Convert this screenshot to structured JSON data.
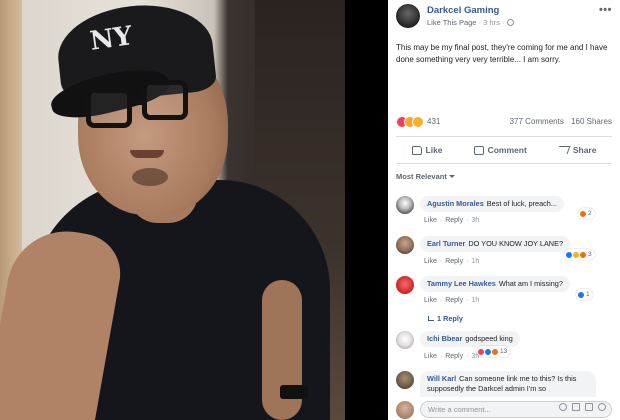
{
  "post": {
    "page_name": "Darkcel Gaming",
    "like_page": "Like This Page",
    "time": "3 hrs",
    "text": "This may be my final post, they're coming for me and I have done something very very terrible... I am sorry.",
    "reaction_count": "431",
    "comments_count": "377 Comments",
    "shares_count": "160 Shares",
    "actions": {
      "like": "Like",
      "comment": "Comment",
      "share": "Share"
    },
    "sort_label": "Most Relevant"
  },
  "comments": [
    {
      "name": "Agustin Morales",
      "text": "Best of luck, preach...",
      "like": "Like",
      "reply": "Reply",
      "time": "3h",
      "reaction_count": "2",
      "avatar_color": "#c8c8c8"
    },
    {
      "name": "Earl Turner",
      "text": "DO YOU KNOW JOY LANE?",
      "like": "Like",
      "reply": "Reply",
      "time": "1h",
      "reaction_count": "3",
      "avatar_color": "#8a6e5a"
    },
    {
      "name": "Tammy Lee Hawkes",
      "text": "What am I missing?",
      "like": "Like",
      "reply": "Reply",
      "time": "1h",
      "reaction_count": "1",
      "avatar_color": "#d42d2d",
      "reply_link": "1 Reply"
    },
    {
      "name": "Ichi Bbear",
      "text": "godspeed king",
      "like": "Like",
      "reply": "Reply",
      "time": "3h",
      "reaction_count": "13",
      "avatar_color": "#d9d9d9"
    },
    {
      "name": "Will Karl",
      "text": "Can someone link me to this? Is this supposedly the Darkcel admin I'm so",
      "avatar_color": "#6b5b45"
    }
  ],
  "composer": {
    "placeholder": "Write a comment..."
  },
  "colors": {
    "link": "#385898",
    "love": "#f33e58",
    "like": "#1877f2",
    "haha": "#f7b125",
    "angry": "#e9710f"
  }
}
